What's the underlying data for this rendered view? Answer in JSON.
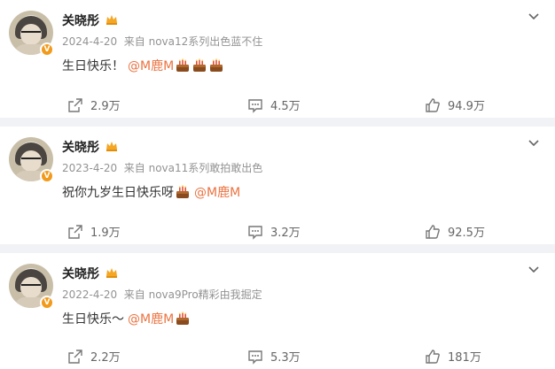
{
  "posts": [
    {
      "author": "关晓彤",
      "date": "2024-4-20",
      "source_prefix": "来自",
      "source": "nova12系列出色蓝不住",
      "text": "生日快乐！",
      "mention": "@M鹿M",
      "cakes": 3,
      "shares": "2.9万",
      "comments": "4.5万",
      "likes": "94.9万"
    },
    {
      "author": "关晓彤",
      "date": "2023-4-20",
      "source_prefix": "来自",
      "source": "nova11系列敢拍敢出色",
      "text": "祝你九岁生日快乐呀",
      "mention": "@M鹿M",
      "cakes": 1,
      "shares": "1.9万",
      "comments": "3.2万",
      "likes": "92.5万"
    },
    {
      "author": "关晓彤",
      "date": "2022-4-20",
      "source_prefix": "来自",
      "source": "nova9Pro精彩由我掘定",
      "text": "生日快乐～",
      "mention": "@M鹿M",
      "cakes": 1,
      "shares": "2.2万",
      "comments": "5.3万",
      "likes": "181万"
    }
  ],
  "colors": {
    "mention": "#eb7340",
    "badge": "#f29a1b",
    "background": "#f1f2f5"
  },
  "icons": {
    "share": "share-icon",
    "comment": "comment-icon",
    "like": "like-icon",
    "menu": "chevron-down-icon",
    "vip": "crown-icon",
    "verified": "verified-v-badge"
  }
}
